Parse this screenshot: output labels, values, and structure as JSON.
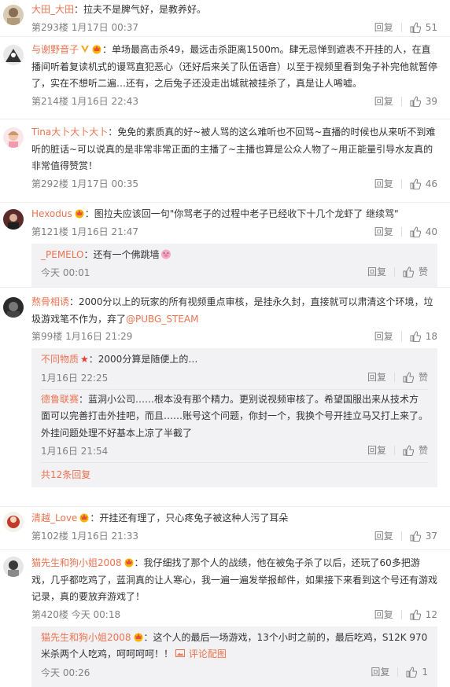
{
  "comments": [
    {
      "user": "大田_大田",
      "text": "：拉夫不是脾气好，是教养好。",
      "floor_time": "第293楼 1月17日 00:37",
      "reply": "回复",
      "likes": "51"
    },
    {
      "user": "与谢野音子",
      "text": "：单场最高击杀49，最远击杀距离1500m。肆无忌惮到遮表不开挂的人，在直播间听着复读机式的谩骂直犯恶心（还好后来关了队伍语音）以至于视频里看到兔子补完他就暂停了，实在不想听二遍…还有，之后兔子还没走出城就被挂杀了，真是让人唏嘘。",
      "floor_time": "第214楼 1月16日 22:43",
      "reply": "回复",
      "likes": "39"
    },
    {
      "user": "Tina大卜大卜大卜",
      "text": "：免免的素质真的好~被人骂的这么难听也不回骂~直播的时候也从来听不到难听的脏话~可以说真的是非常非常正面的主播了~主播也算是公众人物了~用正能量引导水友真的非常值得赞赏！",
      "floor_time": "第292楼 1月17日 00:35",
      "reply": "回复",
      "likes": "46"
    },
    {
      "user": "Hexodus",
      "text": "：图拉夫应该回一句\"你骂老子的过程中老子已经收下十几个龙虾了 继续骂\"",
      "floor_time": "第121楼 1月16日 21:47",
      "reply": "回复",
      "likes": "40",
      "replies": [
        {
          "user": "_PEMELO",
          "text": "：还有一个佛跳墙",
          "time": "今天 00:01",
          "reply": "回复",
          "like": "赞"
        }
      ]
    },
    {
      "user": "熬骨相诱",
      "text": "：2000分以上的玩家的所有视频重点审核，是挂永久封，直接就可以肃清这个环境，垃圾游戏笔不作为，弃了",
      "mention": "@PUBG_STEAM",
      "floor_time": "第99楼 1月16日 21:29",
      "reply": "回复",
      "likes": "18",
      "replies": [
        {
          "user": "不同物质",
          "text": "：2000分算是随便上的…",
          "time": "1月16日 22:25",
          "reply": "回复",
          "like": "赞"
        },
        {
          "user": "德鲁联赛",
          "text": "：蓝洞小公司……根本没有那个精力。更别说视频审核了。希望国服出来从技术方面可以完善打击外挂吧，而且……账号这个问题，你封一个，我换个号开挂立马又打上来了。外挂问题处理不好基本上凉了半截了",
          "time": "1月16日 21:54",
          "reply": "回复",
          "like": "赞"
        }
      ],
      "more": "共12条回复"
    },
    {
      "user": "清越_Love",
      "text": "：开挂还有理了，只心疼兔子被这种人污了耳朵",
      "floor_time": "第102楼 1月16日 21:33",
      "reply": "回复",
      "likes": "37"
    },
    {
      "user": "猫先生和狗小姐2008",
      "text": "：我仔细找了那个人的战绩，他在被兔子杀了以后，还玩了60多把游戏，几乎都吃鸡了，蓝洞真的让人寒心，我一遍一遍发举报邮件，如果接下来看到这个号还有游戏记录，真的要放弃游戏了！",
      "floor_time": "第420楼 今天 00:18",
      "reply": "回复",
      "likes": "12",
      "replies": [
        {
          "user": "猫先生和狗小姐2008",
          "text": "：这个人的最后一场游戏，13个小时之前的，最后吃鸡，S12K 970米杀两个人吃鸡，呵呵呵呵！！",
          "link": "评论配图",
          "time": "今天 00:26",
          "reply": "回复",
          "likes": "1"
        }
      ]
    }
  ],
  "colors": {
    "accent": "#eb7350",
    "meta": "#808080",
    "reply_bg": "#f2f2f5"
  }
}
